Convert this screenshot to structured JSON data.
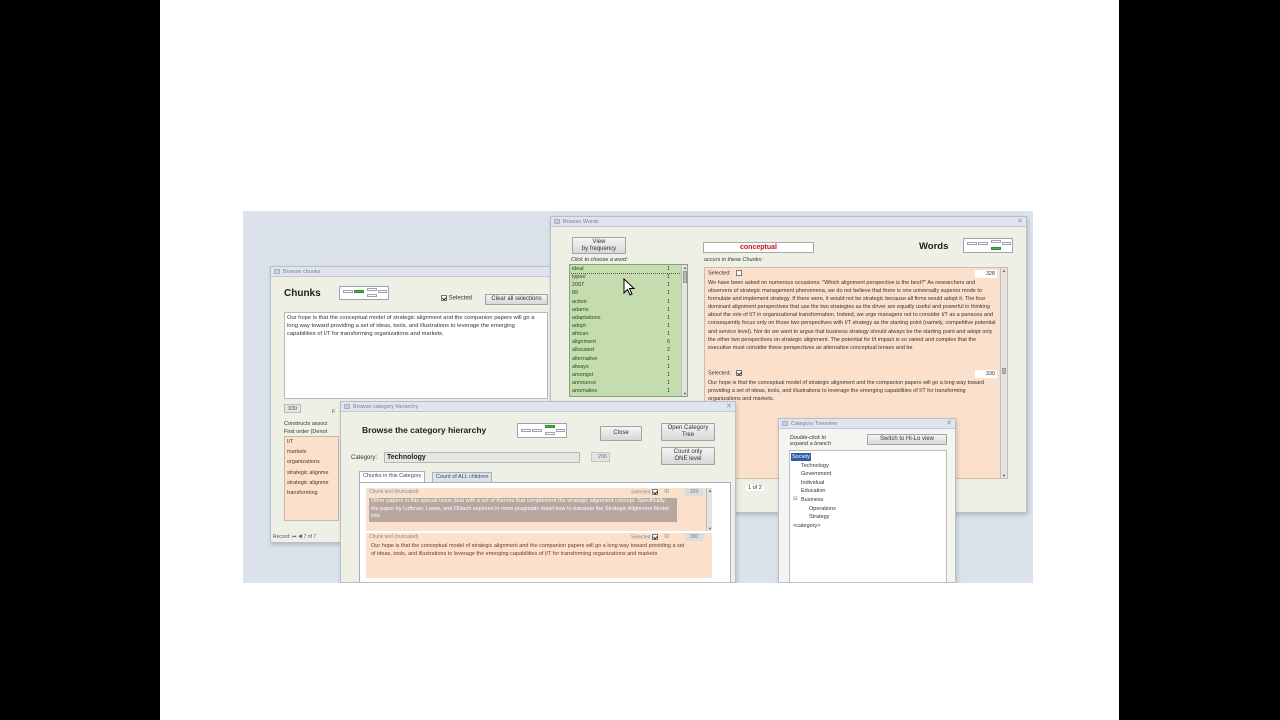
{
  "colors": {
    "slide_bg": "#ffffff",
    "letterbox": "#000000",
    "wordlist_bg": "#c5dcae",
    "peach_bg": "#fbe1cc",
    "highlight": "#b8a6a0",
    "accent_red": "#c4121a",
    "minimap_green": "#43b549",
    "tree_select": "#315aa9"
  },
  "chunks_window": {
    "title": "Browse chunks",
    "heading": "Chunks",
    "selected_label": "Selected",
    "selected_checked": true,
    "clear_button": "Clear all selections",
    "chunk_text": "Our hope is that the conceptual model of strategic alignment and the companion papers will go a long way toward providing a set of ideas, tools, and illustrations to leverage the emerging capabilities of I/T for transforming organizations and markets.",
    "chunk_number": "330",
    "f_label": "F",
    "constructs_label": "Constructs associ",
    "first_order_label": "First order (Denot",
    "constructs": [
      "I/T",
      "markets",
      "organizations",
      "strategic alignme",
      "strategic alignme",
      "transforming"
    ],
    "record_label": "Record:",
    "record_nav": "7 of 7"
  },
  "words_window": {
    "title": "Browse Words",
    "view_button": [
      "View",
      "by frequency"
    ],
    "search_value": "conceptual",
    "heading": "Words",
    "click_hint": "Click to choose a word:",
    "occurs_label": "occurs in these Chunks:",
    "words": [
      {
        "w": "ideal",
        "c": "1"
      },
      {
        "w": "types'",
        "c": "1"
      },
      {
        "w": "2007",
        "c": "1"
      },
      {
        "w": "89",
        "c": "1"
      },
      {
        "w": "action",
        "c": "1"
      },
      {
        "w": "adams",
        "c": "1"
      },
      {
        "w": "adaptations",
        "c": "1"
      },
      {
        "w": "adopt",
        "c": "1"
      },
      {
        "w": "african",
        "c": "1"
      },
      {
        "w": "alignment",
        "c": "6"
      },
      {
        "w": "allocated",
        "c": "2"
      },
      {
        "w": "alternative",
        "c": "1"
      },
      {
        "w": "always",
        "c": "1"
      },
      {
        "w": "amongst",
        "c": "1"
      },
      {
        "w": "announce",
        "c": "1"
      },
      {
        "w": "anomalies",
        "c": "1"
      }
    ],
    "chunk1": {
      "selected_label": "Selected:",
      "selected_checked": false,
      "number": "328",
      "text": "We have been asked on numerous occasions: \"Which alignment perspective is the best?\" As researchers and observers of strategic management phenomena, we do not believe that there is one universally superior mode to formulate and implement strategy. If there were, it would not be strategic because all firms would adopt it. The four dominant alignment perspectives that use the two strategies as the driver are equally useful and powerful in thinking about the role of I/T in organizational transformation. Indeed, we urge managers not to consider I/T as a panacea and consequently focus only on those two perspectives with I/T strategy as the starting point (namely, competitive potential and service level). Nor do we want to argue that business strategy should always be the starting point and adopt only the other two perspectives on strategic alignment. The potential for I/t impact is so varied and complex that the executive must consider these perspectives as alternative conceptual lenses and be"
    },
    "chunk2": {
      "selected_label": "Selected:",
      "selected_checked": true,
      "number": "330",
      "text": "Our hope is that the conceptual model of strategic alignment and the companion papers will go a long way toward providing a set of ideas, tools, and illustrations to leverage the emerging capabilities of I/T for transforming organizations and markets."
    },
    "record_nav": "1 of 2"
  },
  "hierarchy_window": {
    "title": "Browse category hierarchy",
    "heading": "Browse the category hierarchy",
    "close_button": "Close",
    "open_tree_button": [
      "Open Category",
      "Tree"
    ],
    "count_button": [
      "Count only",
      "ONE level"
    ],
    "category_label": "Category:",
    "category_value": "Technology",
    "category_count": "206",
    "tabs": [
      "Chunks in this Category",
      "Count of ALL children"
    ],
    "chunk_header_label": "Chunk text (truncated)",
    "selected_label": "Selected",
    "id_label": "ID",
    "row1": {
      "id": "329",
      "checked": true,
      "text": "Other papers in this special issue deal with a set of themes that complement the strategic alignment concept. Specifically, the paper by Luftman, Lewis, and Oldach explores in more pragmatic detail how to translate the Strategic Alignment Model into"
    },
    "row2": {
      "id": "330",
      "checked": true,
      "text": "Our hope is that the conceptual model of strategic alignment and the companion papers will go a long way toward providing a set of ideas, tools, and illustrations to leverage the emerging capabilities of I/T for transforming organizations and markets"
    }
  },
  "treeview_window": {
    "title": "Category Treeview",
    "hint": [
      "Double-click to",
      "expand a branch"
    ],
    "switch_button": "Switch to Hi-Lo view",
    "nodes": [
      "Society",
      "Technology",
      "Government",
      "Individual",
      "Education",
      "Business",
      "Operations",
      "Strategy",
      "<category>"
    ]
  }
}
